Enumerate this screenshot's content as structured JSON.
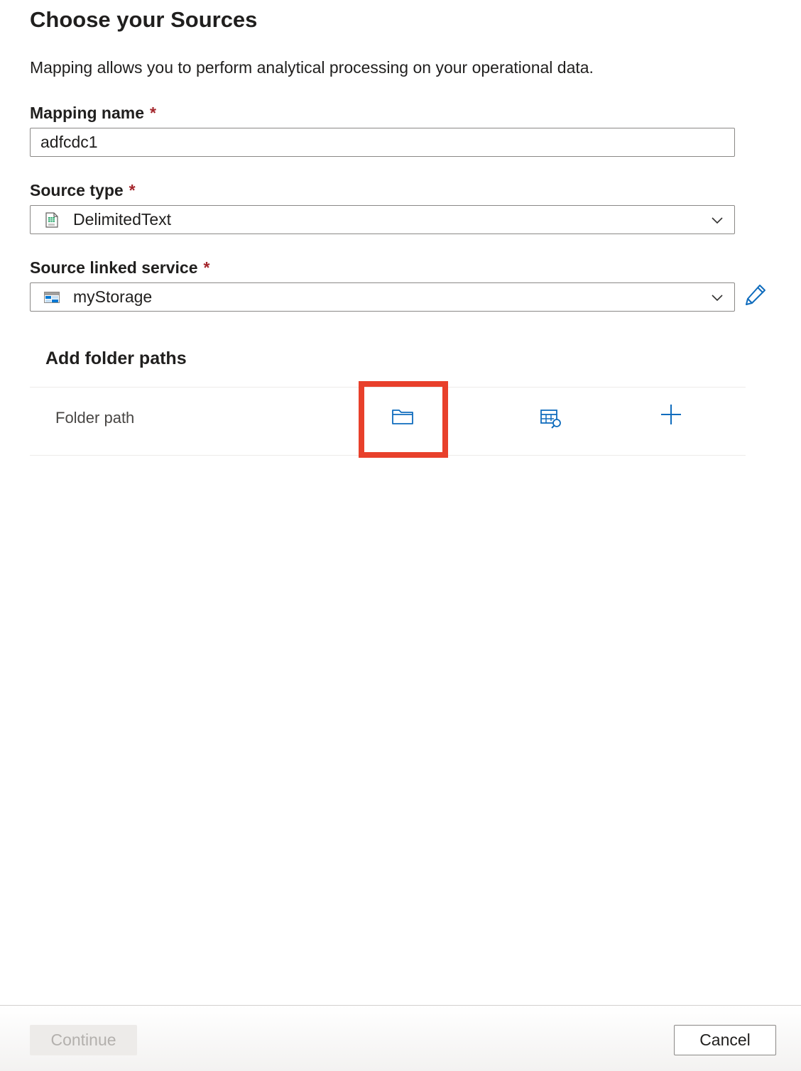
{
  "header": {
    "title": "Choose your Sources",
    "description": "Mapping allows you to perform analytical processing on your operational data."
  },
  "form": {
    "mapping_name": {
      "label": "Mapping name",
      "required_mark": "*",
      "value": "adfcdc1"
    },
    "source_type": {
      "label": "Source type",
      "required_mark": "*",
      "value": "DelimitedText",
      "icon": "csv-file-icon"
    },
    "source_linked_service": {
      "label": "Source linked service",
      "required_mark": "*",
      "value": "myStorage",
      "icon": "storage-account-icon",
      "edit_icon": "pencil-icon"
    }
  },
  "folder_paths": {
    "section_title": "Add folder paths",
    "row_label": "Folder path",
    "actions": [
      "folder-icon",
      "table-preview-icon",
      "add-icon"
    ],
    "highlighted_action": "folder-icon"
  },
  "footer": {
    "continue_label": "Continue",
    "cancel_label": "Cancel",
    "continue_disabled": true
  },
  "colors": {
    "accent": "#0f6cbd",
    "required": "#a4262c",
    "highlight": "#e8402b",
    "border": "#8a8886"
  }
}
